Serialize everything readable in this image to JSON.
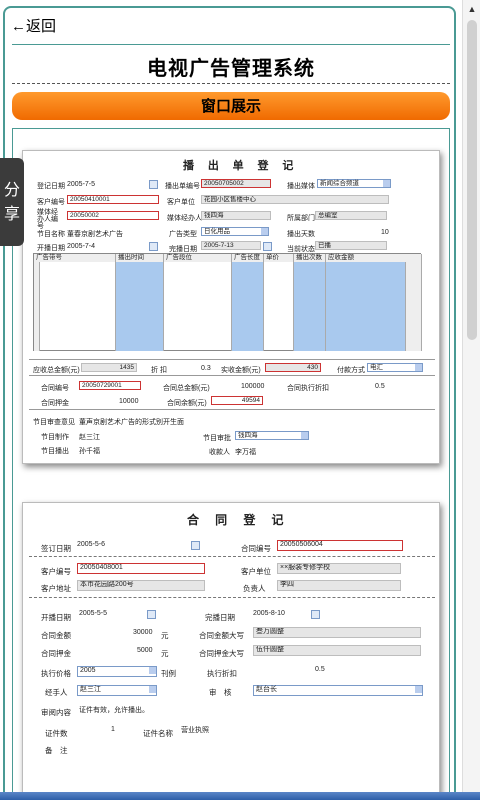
{
  "header": {
    "back_label": "←返回",
    "title": "电视广告管理系统",
    "section_button": "窗口展示",
    "share_label": "分享"
  },
  "broadcast": {
    "title": "播 出 单 登 记",
    "reg_date_label": "登记日期",
    "reg_date": "2005-7-5",
    "bill_no_label": "播出单编号",
    "bill_no": "20050705002",
    "media_label": "播出媒体",
    "media": "新闻综合频道",
    "cust_no_label": "客户编号",
    "cust_no": "20050410001",
    "cust_unit_label": "客户单位",
    "cust_unit": "花园小区售楼中心",
    "agent_no_label": "媒体经办人编号",
    "agent_no": "20050002",
    "agent_label": "媒体经办人",
    "agent": "钱四海",
    "dept_label": "所属部门",
    "dept": "总编室",
    "prog_name_label": "节目名称",
    "prog_name": "董春京剧艺术广告",
    "ad_type_label": "广告类型",
    "ad_type": "日化用品",
    "days_label": "播出天数",
    "days": "10",
    "start_label": "开播日期",
    "start": "2005-7-4",
    "end_label": "完播日期",
    "end": "2005-7-13",
    "state_label": "当前状态",
    "state": "已播",
    "grid_headers": [
      "广告带号",
      "播出时间",
      "广告段位",
      "广告长度",
      "单价",
      "播出次数",
      "应收金额"
    ],
    "receivable_label": "应收总金额(元)",
    "receivable": "1435",
    "discount_label": "折 扣",
    "discount": "0.3",
    "actual_label": "实收金额(元)",
    "actual": "430",
    "pay_label": "付款方式",
    "pay": "电汇",
    "contract_no_label": "合同编号",
    "contract_no": "20050729001",
    "contract_total_label": "合同总金额(元)",
    "contract_total": "100000",
    "exec_discount_label": "合同执行折扣",
    "exec_discount": "0.5",
    "deposit_label": "合同押金",
    "deposit": "10000",
    "contract_amount_label": "合同余额(元)",
    "contract_amount": "49594",
    "review_label": "节目审查意见",
    "review": "董声京剧艺术广告的形式别开生面",
    "producer_label": "节目制作",
    "producer": "赵三江",
    "approver_label": "节目审批",
    "approver": "钱四海",
    "broadcaster_label": "节目播出",
    "broadcaster": "孙千福",
    "cashier_label": "收款人",
    "cashier": "李万福"
  },
  "contract": {
    "title": "合 同 登 记",
    "sign_date_label": "签订日期",
    "sign_date": "2005-5-6",
    "contract_no_label": "合同编号",
    "contract_no": "20050506004",
    "cust_no_label": "客户编号",
    "cust_no": "20050408001",
    "cust_unit_label": "客户单位",
    "cust_unit": "××服装专修学校",
    "address_label": "客户地址",
    "address": "本市花园路200号",
    "person_label": "负责人",
    "person": "李四",
    "start_label": "开播日期",
    "start": "2005-5-5",
    "end_label": "完播日期",
    "end": "2005-8-10",
    "amount_label": "合同金额",
    "amount": "30000",
    "unit1": "元",
    "amount_cap_label": "合同金额大写",
    "amount_cap": "叁万圆整",
    "deposit_label": "合同押金",
    "deposit": "5000",
    "unit2": "元",
    "deposit_cap_label": "合同押金大写",
    "deposit_cap": "伍仟圆整",
    "price_label": "执行价格",
    "price": "2005",
    "price_unit": "刊例",
    "discount_label": "执行折扣",
    "discount": "0.5",
    "handler_label": "经手人",
    "handler": "赵三江",
    "reviewer_label": "审　核",
    "reviewer": "赵台长",
    "review_label": "审阅内容",
    "review": "证件有效，允许播出。",
    "cert_count_label": "证件数",
    "cert_count": "1",
    "cert_name_label": "证件名称",
    "cert_name": "营业执照",
    "remark_label": "备　注"
  }
}
